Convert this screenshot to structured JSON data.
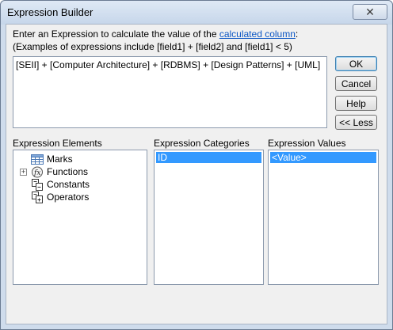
{
  "window": {
    "title": "Expression Builder"
  },
  "instructions": {
    "line1_before_link": "Enter an Expression to calculate the value of the ",
    "line1_link": "calculated column",
    "line1_after_link": ":",
    "line2": "(Examples of expressions include [field1] + [field2] and [field1] < 5)"
  },
  "expression": {
    "value": "[SEII] + [Computer Architecture] + [RDBMS] + [Design Patterns] + [UML]"
  },
  "buttons": {
    "ok": "OK",
    "cancel": "Cancel",
    "help": "Help",
    "less": "<< Less"
  },
  "elements": {
    "label": "Expression Elements",
    "items": [
      {
        "label": "Marks",
        "icon": "table-icon"
      },
      {
        "label": "Functions",
        "icon": "function-icon",
        "expandable": true
      },
      {
        "label": "Constants",
        "icon": "constants-icon"
      },
      {
        "label": "Operators",
        "icon": "operators-icon"
      }
    ]
  },
  "categories": {
    "label": "Expression Categories",
    "items": [
      "ID"
    ],
    "selected": "ID"
  },
  "values": {
    "label": "Expression Values",
    "items": [
      "<Value>"
    ],
    "selected": "<Value>"
  },
  "colors": {
    "selection": "#3399ff",
    "link": "#0b56c4",
    "frame": "#cfdcec"
  }
}
